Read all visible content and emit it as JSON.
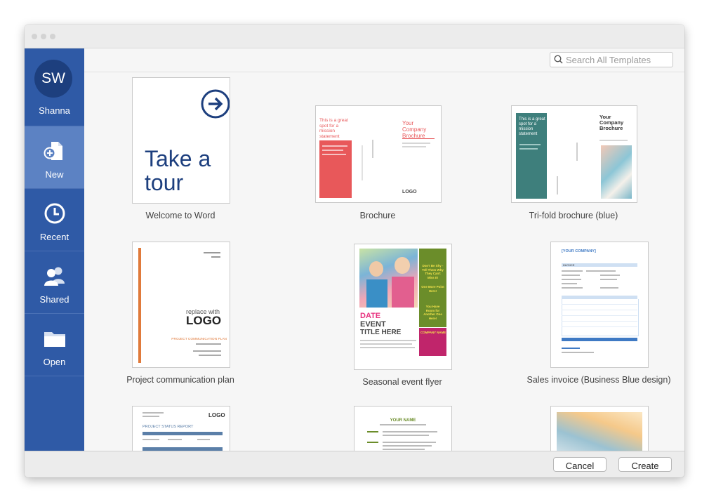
{
  "user": {
    "initials": "SW",
    "name": "Shanna"
  },
  "nav": [
    {
      "label": "New",
      "icon": "new-document-icon",
      "active": true
    },
    {
      "label": "Recent",
      "icon": "clock-icon"
    },
    {
      "label": "Shared",
      "icon": "people-icon"
    },
    {
      "label": "Open",
      "icon": "folder-icon"
    }
  ],
  "search": {
    "placeholder": "Search All Templates"
  },
  "templates": [
    {
      "name": "Welcome to Word",
      "thumb": {
        "line1": "Take a",
        "line2": "tour"
      }
    },
    {
      "name": "Brochure",
      "thumb": {
        "left_heading": "This is a great spot for a mission statement",
        "right_heading": "Your Company Brochure",
        "logo": "LOGO"
      }
    },
    {
      "name": "Tri-fold brochure (blue)",
      "thumb": {
        "left_heading": "This is a great spot for a mission statement",
        "right_heading": "Your Company Brochure"
      }
    },
    {
      "name": "Project communication plan",
      "thumb": {
        "small": "replace with",
        "logo": "LOGO",
        "title": "PROJECT COMMUNICATION PLAN"
      }
    },
    {
      "name": "Seasonal event flyer",
      "thumb": {
        "date": "DATE",
        "event": "EVENT",
        "title": "TITLE HERE",
        "side1": "Don't Be Shy - Tell Them Why They Can't Miss It!",
        "side2": "One More Point Here!",
        "side3": "You Have Room for Another One Here!",
        "company": "COMPANY NAME"
      }
    },
    {
      "name": "Sales invoice (Business Blue design)",
      "thumb": {
        "company": "[YOUR COMPANY]",
        "invoice": "INVOICE"
      }
    },
    {
      "name": "",
      "thumb": {
        "title": "PROJECT STATUS REPORT",
        "logo": "LOGO"
      }
    },
    {
      "name": "",
      "thumb": {
        "name": "YOUR NAME"
      }
    },
    {
      "name": "",
      "thumb": {}
    }
  ],
  "buttons": {
    "cancel": "Cancel",
    "create": "Create"
  },
  "colors": {
    "sidebar": "#2f5aa6",
    "sidebar_active": "#5c82c3",
    "word_blue": "#1d3f7e",
    "coral": "#e8585a",
    "teal": "#3e7f7c",
    "orange": "#e07a3b",
    "flyer_green": "#6b8d2a",
    "flyer_pink": "#c0256b",
    "invoice_blue": "#3f7ac4"
  }
}
